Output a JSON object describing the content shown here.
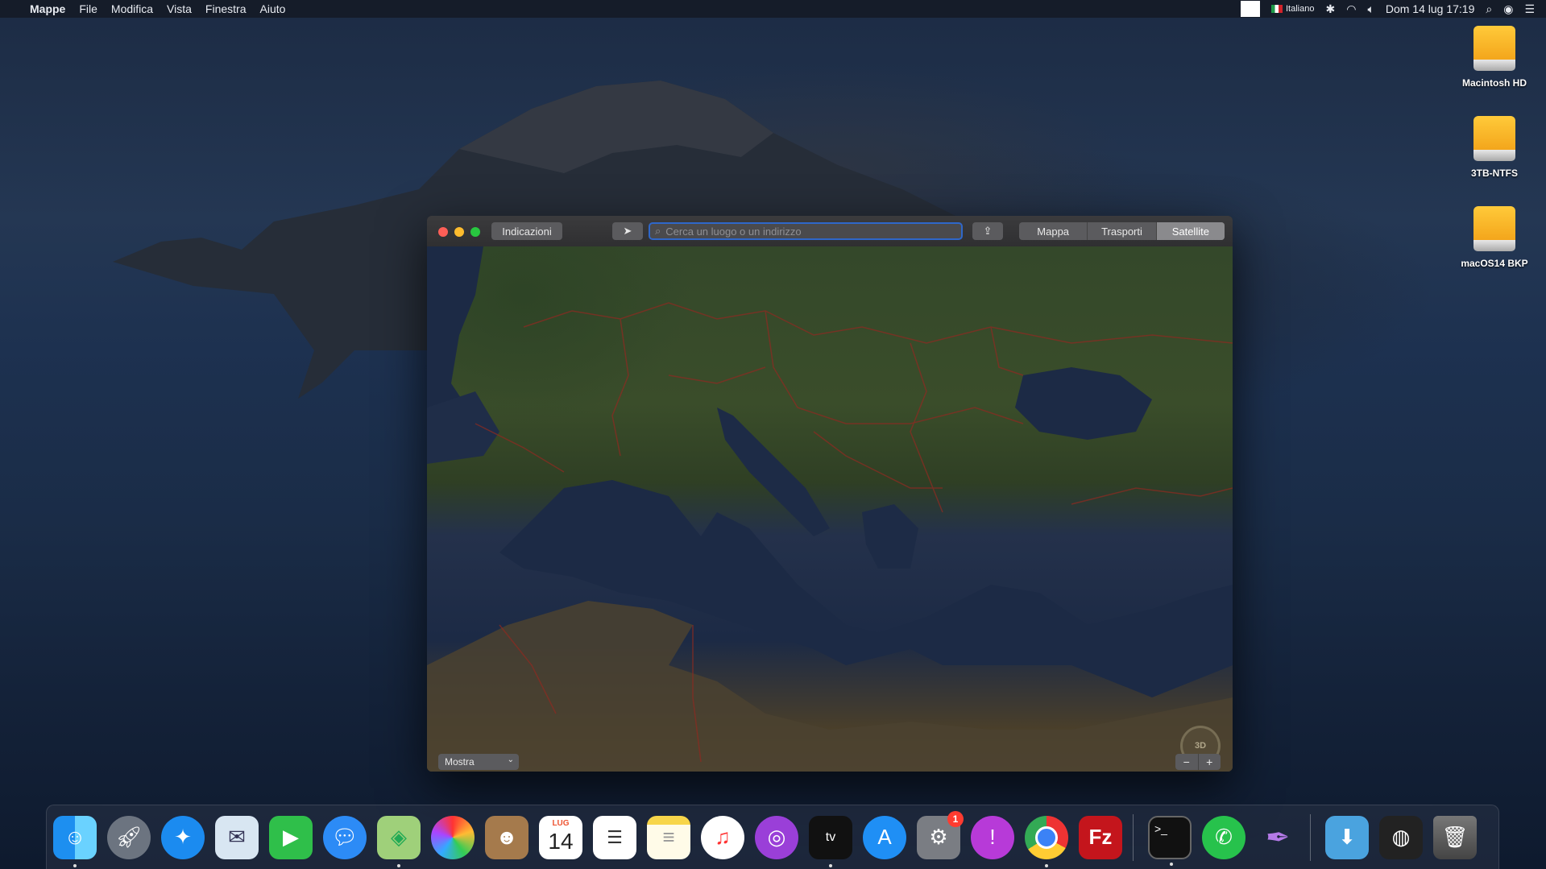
{
  "menubar": {
    "app_name": "Mappe",
    "menus": [
      "File",
      "Modifica",
      "Vista",
      "Finestra",
      "Aiuto"
    ],
    "input_source": "Italiano",
    "clock": "Dom 14 lug  17:19"
  },
  "desktop": {
    "drives": [
      {
        "label": "Macintosh HD"
      },
      {
        "label": "3TB-NTFS"
      },
      {
        "label": "macOS14 BKP"
      }
    ]
  },
  "maps_window": {
    "directions_button": "Indicazioni",
    "search_placeholder": "Cerca un luogo o un indirizzo",
    "view_modes": [
      "Mappa",
      "Trasporti",
      "Satellite"
    ],
    "active_view": "Satellite",
    "show_menu": "Mostra",
    "compass_label": "3D",
    "zoom_out": "−",
    "zoom_in": "+"
  },
  "dock": {
    "calendar_month": "LUG",
    "calendar_day": "14",
    "settings_badge": "1",
    "items": [
      "finder-icon",
      "launchpad-icon",
      "safari-icon",
      "mail-icon",
      "facetime-icon",
      "messages-icon",
      "maps-icon",
      "photos-icon",
      "contacts-icon",
      "calendar-icon",
      "reminders-icon",
      "notes-icon",
      "music-icon",
      "podcasts-icon",
      "tv-icon",
      "appstore-icon",
      "system-preferences-icon",
      "feedback-icon",
      "chrome-icon",
      "filezilla-icon",
      "terminal-icon",
      "whatsapp-icon",
      "quill-icon",
      "downloads-folder-icon",
      "chrome-app-icon",
      "trash-icon"
    ]
  }
}
